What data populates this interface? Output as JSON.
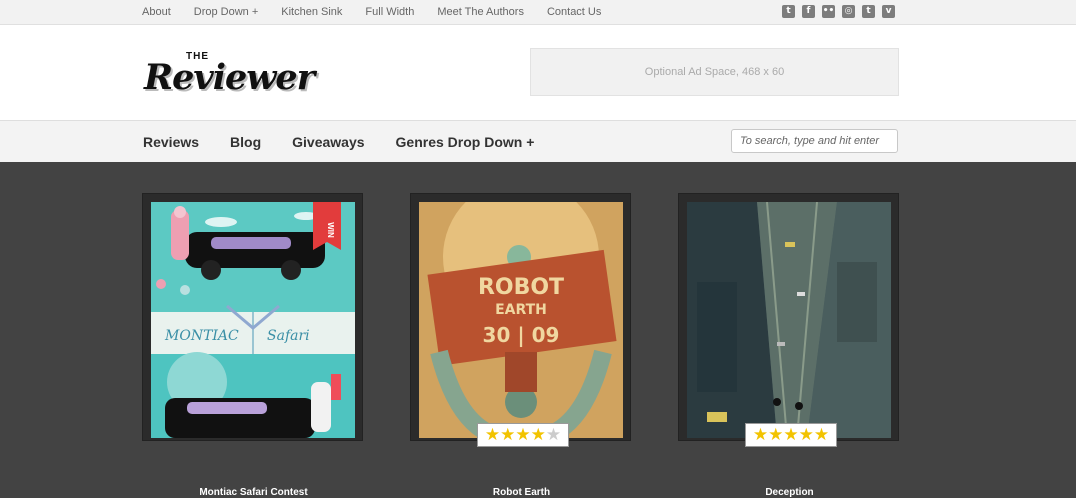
{
  "topnav": {
    "items": [
      "About",
      "Drop Down +",
      "Kitchen Sink",
      "Full Width",
      "Meet The Authors",
      "Contact Us"
    ]
  },
  "social": {
    "icons": [
      {
        "name": "twitter-icon",
        "glyph": "t"
      },
      {
        "name": "facebook-icon",
        "glyph": "f"
      },
      {
        "name": "flickr-icon",
        "glyph": "••"
      },
      {
        "name": "dribbble-icon",
        "glyph": "◎"
      },
      {
        "name": "tumblr-icon",
        "glyph": "t"
      },
      {
        "name": "vimeo-icon",
        "glyph": "v"
      }
    ]
  },
  "header": {
    "logo_top": "THE",
    "logo_main": "Reviewer",
    "ad_text": "Optional Ad Space, 468 x 60"
  },
  "mainnav": {
    "items": [
      "Reviews",
      "Blog",
      "Giveaways",
      "Genres Drop Down +"
    ]
  },
  "search": {
    "placeholder": "To search, type and hit enter"
  },
  "cards": [
    {
      "title": "Montiac Safari Contest",
      "ribbon": "WIN",
      "poster_text_left": "MONTIAC",
      "poster_text_right": "Safari"
    },
    {
      "title": "Robot Earth",
      "poster_line1": "ROBOT",
      "poster_line2": "EARTH",
      "poster_line3": "30 | 09",
      "rating": 4.5,
      "rating_stars": "★★★★",
      "rating_half": "★"
    },
    {
      "title": "Deception",
      "rating": 5,
      "rating_stars": "★★★★★"
    }
  ],
  "colors": {
    "background": "#434343",
    "card": "#2b2b2b",
    "star": "#f2c300"
  }
}
